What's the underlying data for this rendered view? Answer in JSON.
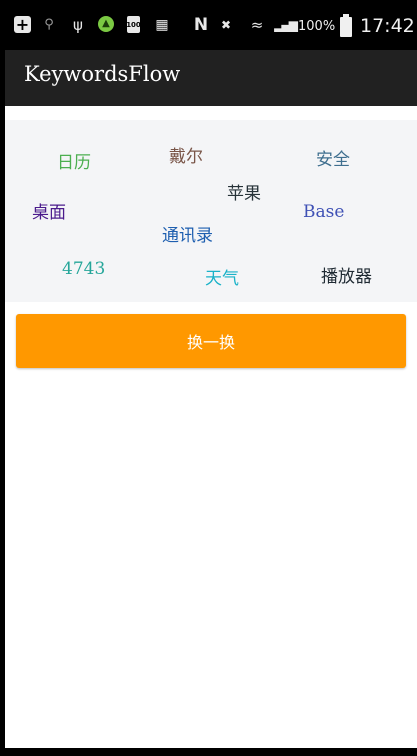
{
  "status_bar": {
    "icons": [
      "add-icon",
      "search-icon",
      "usb-icon",
      "app-notification-icon",
      "battery-full-icon",
      "document-icon",
      "nfc-icon",
      "mute-icon",
      "wifi-icon",
      "signal-icon"
    ],
    "battery_percent": "100%",
    "time": "17:42"
  },
  "app_bar": {
    "title": "KeywordsFlow"
  },
  "keywords": [
    {
      "label": "日历",
      "color": "#4caf50"
    },
    {
      "label": "戴尔",
      "color": "#795548"
    },
    {
      "label": "安全",
      "color": "#3f6f8f"
    },
    {
      "label": "苹果",
      "color": "#263238"
    },
    {
      "label": "桌面",
      "color": "#4a1a8c"
    },
    {
      "label": "Base",
      "color": "#3f51b5"
    },
    {
      "label": "通讯录",
      "color": "#1e5fb0"
    },
    {
      "label": "4743",
      "color": "#26a69a"
    },
    {
      "label": "天气",
      "color": "#1ab2c8"
    },
    {
      "label": "播放器",
      "color": "#1f2a33"
    }
  ],
  "swap_button": {
    "label": "换一换",
    "color": "#ff9800"
  }
}
